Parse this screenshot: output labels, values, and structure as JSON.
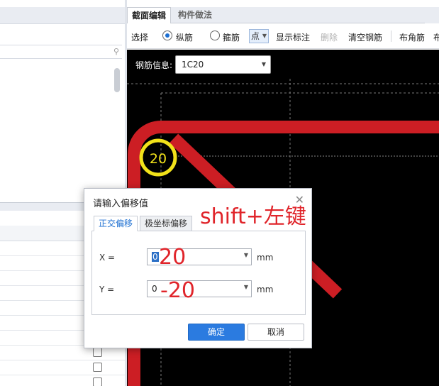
{
  "editor": {
    "tabs": [
      {
        "label": "截面编辑",
        "active": true
      },
      {
        "label": "构件做法",
        "active": false
      }
    ],
    "toolbar": {
      "select_label": "选择",
      "longitudinal_label": "纵筋",
      "longitudinal_selected": true,
      "stirrup_label": "箍筋",
      "stirrup_selected": false,
      "mode_value": "点",
      "show_label": "显示标注",
      "delete_label": "删除",
      "delete_enabled": false,
      "clear_label": "清空钢筋",
      "corner_label": "布角筋",
      "overflow_label": "布"
    },
    "rebar_info": {
      "label": "钢筋信息:",
      "value": "1C20"
    },
    "canvas": {
      "rebar_marker_text": "20",
      "rebar_color": "#cc1e24",
      "marker_color": "#f2e21a"
    }
  },
  "dialog": {
    "title": "请输入偏移值",
    "tabs": [
      {
        "label": "正交偏移",
        "active": true
      },
      {
        "label": "极坐标偏移",
        "active": false
      }
    ],
    "fields": [
      {
        "label": "X =",
        "value": "0",
        "unit": "mm"
      },
      {
        "label": "Y =",
        "value": "0",
        "unit": "mm"
      }
    ],
    "ok_label": "确定",
    "cancel_label": "取消"
  },
  "annotations": {
    "shortcut": "shift+左键",
    "x_offset": "20",
    "y_offset": "-20",
    "color": "#e0242a"
  }
}
